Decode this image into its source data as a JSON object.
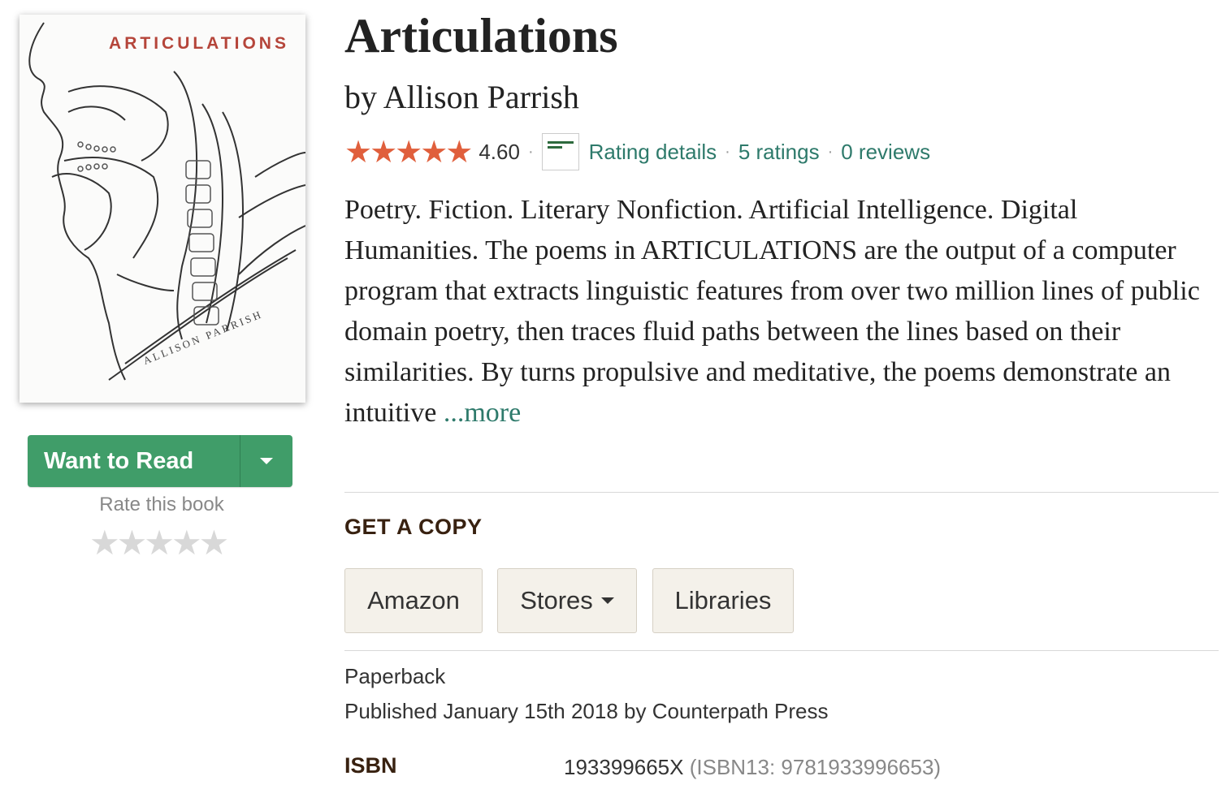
{
  "cover": {
    "title": "ARTICULATIONS",
    "author": "ALLISON PARRISH"
  },
  "shelf": {
    "want_label": "Want to Read",
    "rate_label": "Rate this book",
    "rate_stars": "★★★★★"
  },
  "book": {
    "title": "Articulations",
    "byline": "by Allison Parrish",
    "stars": "★★★★★",
    "average": "4.60",
    "rating_details": "Rating details",
    "ratings": "5 ratings",
    "reviews": "0 reviews",
    "description": "Poetry. Fiction. Literary Nonfiction. Artificial Intelligence. Digital Humanities. The poems in ARTICULATIONS are the output of a computer program that extracts linguistic features from over two million lines of public domain poetry, then traces fluid paths between the lines based on their similarities. By turns propulsive and meditative, the poems demonstrate an intuitive ",
    "more": "...more"
  },
  "copy": {
    "heading": "GET A COPY",
    "amazon": "Amazon",
    "stores": "Stores",
    "libraries": "Libraries"
  },
  "details": {
    "format": "Paperback",
    "published": "Published January 15th 2018 by Counterpath Press",
    "isbn_label": "ISBN",
    "isbn": "193399665X",
    "isbn13": "(ISBN13: 9781933996653)"
  },
  "colors": {
    "accent_green": "#409d69",
    "link": "#2e7a6b",
    "star": "#e05f3c"
  }
}
